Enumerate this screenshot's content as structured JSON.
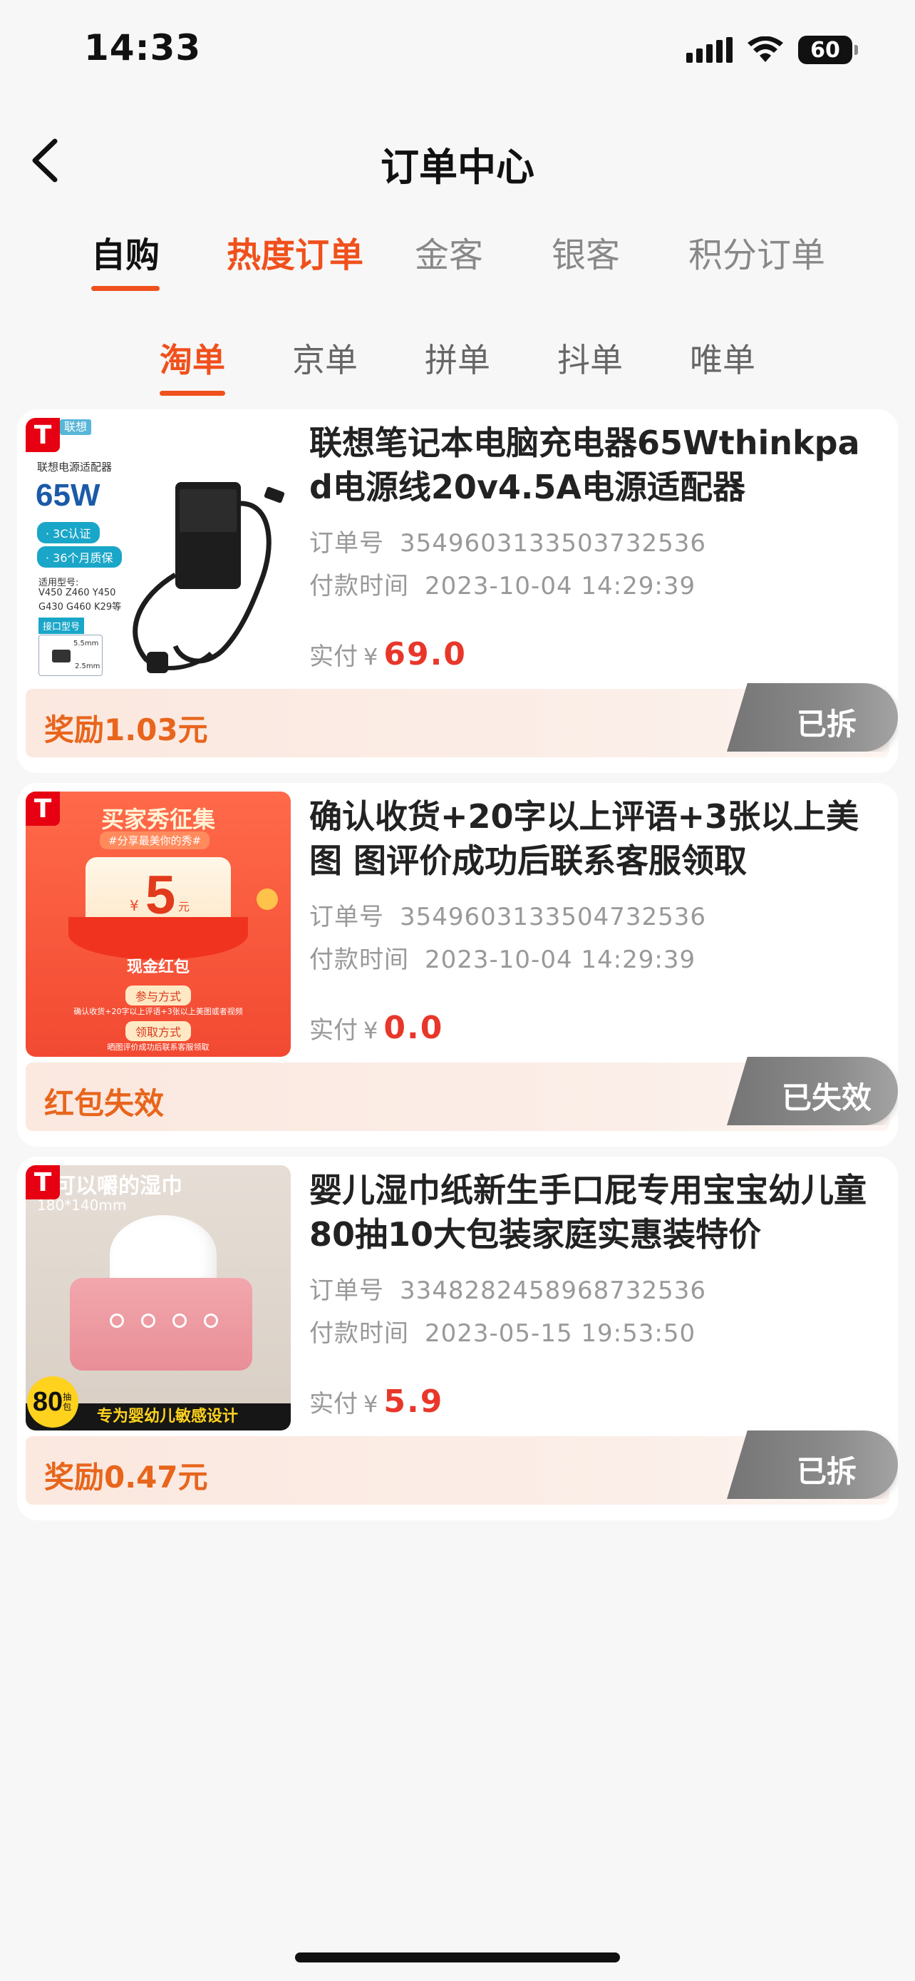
{
  "status_bar": {
    "time": "14:33",
    "battery": "60"
  },
  "header": {
    "title": "订单中心"
  },
  "main_tabs": [
    {
      "label": "自购"
    },
    {
      "label": "热度订单"
    },
    {
      "label": "金客"
    },
    {
      "label": "银客"
    },
    {
      "label": "积分订单"
    }
  ],
  "sub_tabs": [
    {
      "label": "淘单"
    },
    {
      "label": "京单"
    },
    {
      "label": "拼单"
    },
    {
      "label": "抖单"
    },
    {
      "label": "唯单"
    }
  ],
  "labels": {
    "order_no": "订单号",
    "pay_time": "付款时间",
    "paid": "实付",
    "currency": "¥"
  },
  "orders": [
    {
      "badge": "T",
      "title": "联想笔记本电脑充电器65Wthinkpad电源线20v4.5A电源适配器",
      "order_no": "3549603133503732536",
      "pay_time": "2023-10-04 14:29:39",
      "amount": "69.0",
      "reward": "奖励1.03元",
      "status": "已拆",
      "thumb": {
        "brand": "联想",
        "caption": "联想电源适配器",
        "watt": "65W",
        "tag1": "· 3C认证",
        "tag2": "· 36个月质保",
        "models_label": "适用型号:",
        "models_1": "V450 Z460 Y450",
        "models_2": "G430 G460 K29等",
        "port_label": "接口型号",
        "port_a": "5.5mm",
        "port_b": "2.5mm"
      }
    },
    {
      "badge": "T",
      "title": "确认收货+20字以上评语+3张以上美图  图评价成功后联系客服领取",
      "order_no": "3549603133504732536",
      "pay_time": "2023-10-04 14:29:39",
      "amount": "0.0",
      "reward": "红包失效",
      "status": "已失效",
      "thumb": {
        "headline": "买家秀征集",
        "hashtag": "#分享最美你的秀#",
        "value": "5",
        "currency": "¥",
        "unit": "元",
        "cash": "现金红包",
        "how": "参与方式",
        "how_desc": "确认收货+20字以上评语+3张以上美图或者视频",
        "claim": "领取方式",
        "claim_desc": "晒图评价成功后联系客服领取"
      }
    },
    {
      "badge": "T",
      "title": "婴儿湿巾纸新生手口屁专用宝宝幼儿童80抽10大包装家庭实惠装特价",
      "order_no": "3348282458968732536",
      "pay_time": "2023-05-15 19:53:50",
      "amount": "5.9",
      "reward": "奖励0.47元",
      "status": "已拆",
      "thumb": {
        "headline": "可以嚼的湿巾",
        "size": "180*140mm",
        "count": "80",
        "count_unit": "抽包",
        "slogan": "专为婴幼儿敏感设计"
      }
    }
  ]
}
